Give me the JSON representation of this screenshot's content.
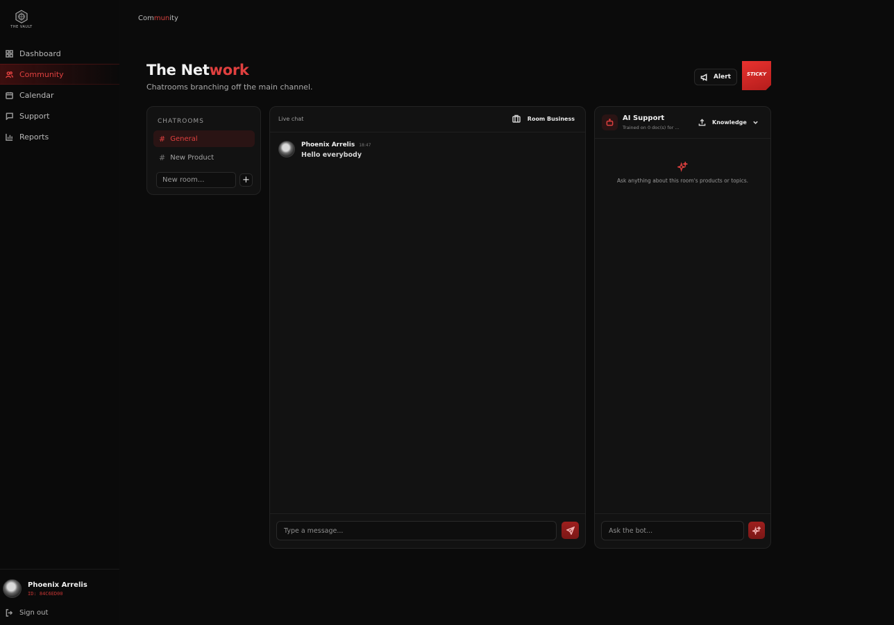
{
  "app": {
    "logo_text": "THE VAULT"
  },
  "sidebar": {
    "items": [
      {
        "label": "Dashboard",
        "icon": "dashboard-icon"
      },
      {
        "label": "Community",
        "icon": "users-icon",
        "active": true
      },
      {
        "label": "Calendar",
        "icon": "calendar-icon"
      },
      {
        "label": "Support",
        "icon": "message-square-icon"
      },
      {
        "label": "Reports",
        "icon": "bar-chart-icon"
      }
    ],
    "user": {
      "name": "Phoenix Arrelis",
      "id": "ID: 84C6ED00"
    },
    "signout_label": "Sign out"
  },
  "breadcrumb": {
    "part1": "Com",
    "part2": "mun",
    "part3": "ity"
  },
  "header": {
    "title_plain": "The Net",
    "title_highlight": "work",
    "subtitle": "Chatrooms branching off the main channel.",
    "alert_label": "Alert",
    "sticky_label": "STICKY"
  },
  "chatrooms": {
    "heading": "CHATROOMS",
    "rooms": [
      {
        "name": "General",
        "active": true
      },
      {
        "name": "New Product",
        "active": false
      }
    ],
    "new_room_placeholder": "New room...",
    "add_label": "+"
  },
  "chat": {
    "label": "Live chat",
    "room_button": "Room Business",
    "messages": [
      {
        "author": "Phoenix Arrelis",
        "time": "18:47",
        "text": "Hello everybody"
      }
    ],
    "input_placeholder": "Type a message..."
  },
  "ai_support": {
    "title": "AI Support",
    "subtitle": "Trained on 0 doc(s) for ...",
    "knowledge_label": "Knowledge",
    "empty_text": "Ask anything about this room's products or topics.",
    "input_placeholder": "Ask the bot..."
  },
  "colors": {
    "accent": "#e0403f",
    "background": "#0b0b0b",
    "panel": "#121212"
  }
}
